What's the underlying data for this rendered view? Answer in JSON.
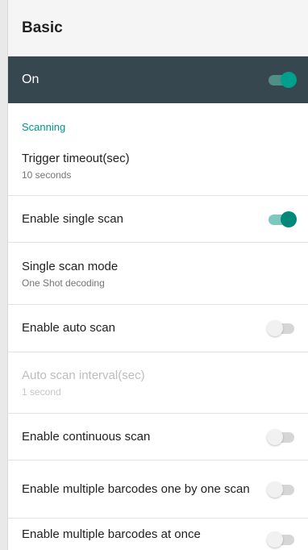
{
  "header": {
    "title": "Basic"
  },
  "master": {
    "label": "On",
    "enabled": true
  },
  "category": {
    "label": "Scanning"
  },
  "settings": [
    {
      "title": "Trigger timeout(sec)",
      "summary": "10 seconds"
    },
    {
      "title": "Enable single scan",
      "switch": "on"
    },
    {
      "title": "Single scan mode",
      "summary": "One Shot decoding"
    },
    {
      "title": "Enable auto scan",
      "switch": "off"
    },
    {
      "title": "Auto scan interval(sec)",
      "summary": "1 second",
      "disabled": true
    },
    {
      "title": "Enable continuous scan",
      "switch": "off"
    },
    {
      "title": "Enable multiple barcodes one by one scan",
      "switch": "off"
    },
    {
      "title": "Enable multiple barcodes at once",
      "switch": "off"
    }
  ],
  "colors": {
    "accent": "#009688",
    "master_bar": "#37474f"
  }
}
